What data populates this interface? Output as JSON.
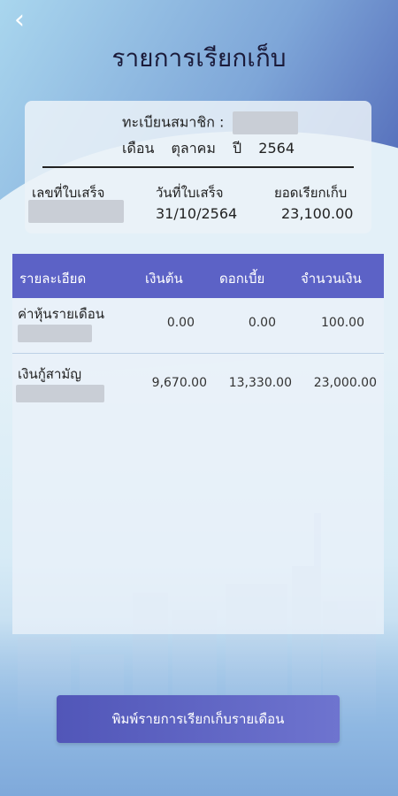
{
  "header": {
    "title": "รายการเรียกเก็บ"
  },
  "member": {
    "label": "ทะเบียนสมาชิก :",
    "month_label": "เดือน",
    "month_value": "ตุลาคม",
    "year_label": "ปี",
    "year_value": "2564"
  },
  "receipt": {
    "col_receipt_no": "เลขที่ใบเสร็จ",
    "col_receipt_date": "วันที่ใบเสร็จ",
    "col_total": "ยอดเรียกเก็บ",
    "receipt_date": "31/10/2564",
    "total": "23,100.00"
  },
  "table": {
    "headers": [
      "รายละเอียด",
      "เงินต้น",
      "ดอกเบี้ย",
      "จำนวนเงิน"
    ],
    "rows": [
      {
        "name": "ค่าหุ้นรายเดือน",
        "principal": "0.00",
        "interest": "0.00",
        "amount": "100.00"
      },
      {
        "name": "เงินกู้สามัญ",
        "principal": "9,670.00",
        "interest": "13,330.00",
        "amount": "23,000.00"
      }
    ]
  },
  "actions": {
    "print_label": "พิมพ์รายการเรียกเก็บรายเดือน"
  }
}
